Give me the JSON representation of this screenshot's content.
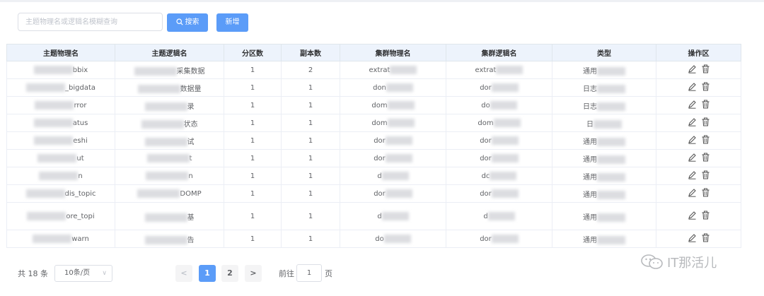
{
  "toolbar": {
    "search_placeholder": "主题物理名或逻辑名模糊查询",
    "search_label": "搜索",
    "add_label": "新增"
  },
  "table": {
    "headers": [
      "主题物理名",
      "主题逻辑名",
      "分区数",
      "副本数",
      "集群物理名",
      "集群逻辑名",
      "类型",
      "操作区"
    ],
    "rows": [
      {
        "physical": "bbix",
        "logical": "采集数据",
        "partitions": "1",
        "replicas": "2",
        "cluster_physical": "extrat",
        "cluster_logical": "extrat",
        "type": "通用"
      },
      {
        "physical": "_bigdata",
        "logical": "数据量",
        "partitions": "1",
        "replicas": "1",
        "cluster_physical": "don",
        "cluster_logical": "dor",
        "type": "日志"
      },
      {
        "physical": "rror",
        "logical": "录",
        "partitions": "1",
        "replicas": "1",
        "cluster_physical": "dom",
        "cluster_logical": "do",
        "type": "日志"
      },
      {
        "physical": "atus",
        "logical": "状态",
        "partitions": "1",
        "replicas": "1",
        "cluster_physical": "dom",
        "cluster_logical": "dom",
        "type": "日"
      },
      {
        "physical": "eshi",
        "logical": "试",
        "partitions": "1",
        "replicas": "1",
        "cluster_physical": "dor",
        "cluster_logical": "dor",
        "type": "通用"
      },
      {
        "physical": "ut",
        "logical": "t",
        "partitions": "1",
        "replicas": "1",
        "cluster_physical": "dor",
        "cluster_logical": "dor",
        "type": "通用"
      },
      {
        "physical": "n",
        "logical": "n",
        "partitions": "1",
        "replicas": "1",
        "cluster_physical": "d",
        "cluster_logical": "dc",
        "type": "通用"
      },
      {
        "physical": "dis_topic",
        "logical": "DOMP",
        "partitions": "1",
        "replicas": "1",
        "cluster_physical": "dor",
        "cluster_logical": "dor",
        "type": "通用"
      },
      {
        "physical": "ore_topi",
        "logical": "基",
        "partitions": "1",
        "replicas": "1",
        "cluster_physical": "d",
        "cluster_logical": "d",
        "type": "通用"
      },
      {
        "physical": "warn",
        "logical": "告",
        "partitions": "1",
        "replicas": "1",
        "cluster_physical": "do",
        "cluster_logical": "dor",
        "type": "通用"
      }
    ]
  },
  "pagination": {
    "total": "共 18 条",
    "page_size": "10条/页",
    "prev": "<",
    "page1": "1",
    "page2": "2",
    "next": ">",
    "goto_label": "前往",
    "goto_value": "1",
    "goto_unit": "页"
  },
  "watermark": {
    "text": "IT那活儿"
  },
  "icons": {
    "search": "search-icon",
    "edit": "edit-icon",
    "delete": "trash-icon",
    "dropdown": "chevron-down-icon",
    "watermark": "wechat-icon"
  },
  "colors": {
    "primary": "#5b9cf8",
    "header_bg": "#edf3fc"
  }
}
